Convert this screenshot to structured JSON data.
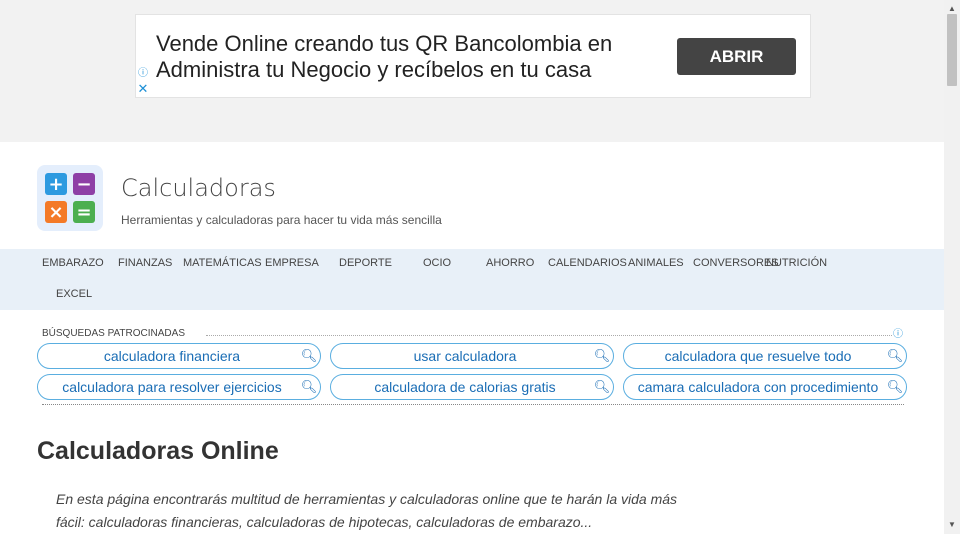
{
  "ad": {
    "text": "Vende Online creando tus QR Bancolombia en Administra tu Negocio y recíbelos en tu casa",
    "button_label": "ABRIR",
    "info_glyph": "ⓘ",
    "close_glyph": "✕"
  },
  "scrollbar": {
    "up_glyph": "▲",
    "down_glyph": "▼"
  },
  "header": {
    "logo_symbols": [
      "+",
      "−",
      "×",
      "="
    ],
    "logo_colors": [
      "#2d9ae0",
      "#8e3fa6",
      "#f47a28",
      "#4caf50"
    ],
    "title": "Calculadoras",
    "tagline": "Herramientas y calculadoras para hacer tu vida más sencilla"
  },
  "nav": {
    "items": [
      "EMBARAZO",
      "FINANZAS",
      "MATEMÁTICAS",
      "EMPRESA",
      "DEPORTE",
      "OCIO",
      "AHORRO",
      "CALENDARIOS",
      "ANIMALES",
      "CONVERSORES",
      "NUTRICIÓN",
      "EXCEL"
    ]
  },
  "sponsored": {
    "heading": "BÚSQUEDAS PATROCINADAS",
    "info_glyph": "ⓘ",
    "search_glyph": "🔍︎",
    "searches": [
      "calculadora financiera",
      "usar calculadora",
      "calculadora que resuelve todo",
      "calculadora para resolver ejercicios",
      "calculadora de calorias gratis",
      "camara calculadora con procedimiento"
    ]
  },
  "main": {
    "heading": "Calculadoras Online",
    "intro": "En esta página encontrarás multitud de herramientas y calculadoras online que te harán la vida más fácil: calculadoras financieras, calculadoras de hipotecas, calculadoras de embarazo..."
  }
}
